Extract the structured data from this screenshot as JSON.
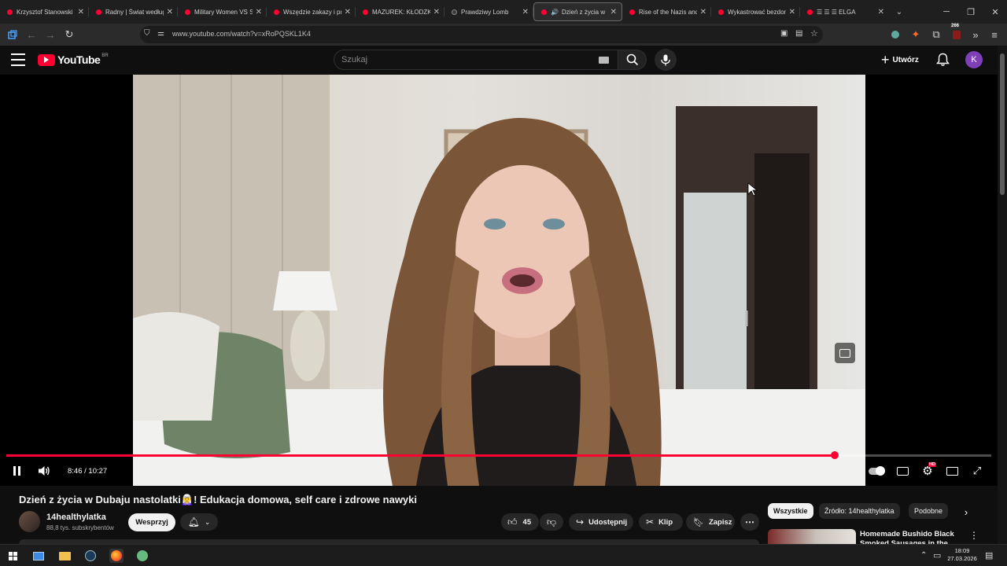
{
  "browser": {
    "tabs": [
      {
        "title": "Krzysztof Stanowski"
      },
      {
        "title": "Radny | Świat według"
      },
      {
        "title": "Military Women VS S"
      },
      {
        "title": "Wszędzie zakazy i pr"
      },
      {
        "title": "MAZUREK: KŁODZKO"
      },
      {
        "title": "Prawdziwy Lomb"
      },
      {
        "title": "Dzień z życia w D"
      },
      {
        "title": "Rise of the Nazis and"
      },
      {
        "title": "Wykastrować bezdom"
      },
      {
        "title": "☰ ☰ ☰ ELGA"
      }
    ],
    "url": "www.youtube.com/watch?v=xRoPQSKL1K4",
    "extension_badge": "266"
  },
  "youtube": {
    "logo_text": "YouTube",
    "logo_country": "BR",
    "search_placeholder": "Szukaj",
    "create_label": "Utwórz",
    "avatar_letter": "K"
  },
  "player": {
    "time_display": "8:46 / 10:27",
    "current_time": "8:46",
    "duration": "10:27",
    "progress_fraction": 0.841,
    "settings_badge": "HD"
  },
  "video": {
    "title": "Dzień z życia w Dubaju nastolatki🧝‍♀️! Edukacja domowa, self care i zdrowe nawyki",
    "channel_name": "14healthylatka",
    "subscribers": "88,8 tys. subskrybentów",
    "support_label": "Wesprzyj",
    "likes": "45",
    "share_label": "Udostępnij",
    "clip_label": "Klip",
    "save_label": "Zapisz"
  },
  "sidebar": {
    "chips": [
      "Wszystkie",
      "Źródło: 14healthylatka",
      "Podobne"
    ],
    "next_video_title": "Homemade Bushido Black Smoked Sausages in the"
  },
  "taskbar": {
    "time": "18:09",
    "date": "27.03.2026"
  },
  "colors": {
    "accent": "#ff0033",
    "background": "#0f0f0f",
    "avatar": "#7e3fb8"
  }
}
